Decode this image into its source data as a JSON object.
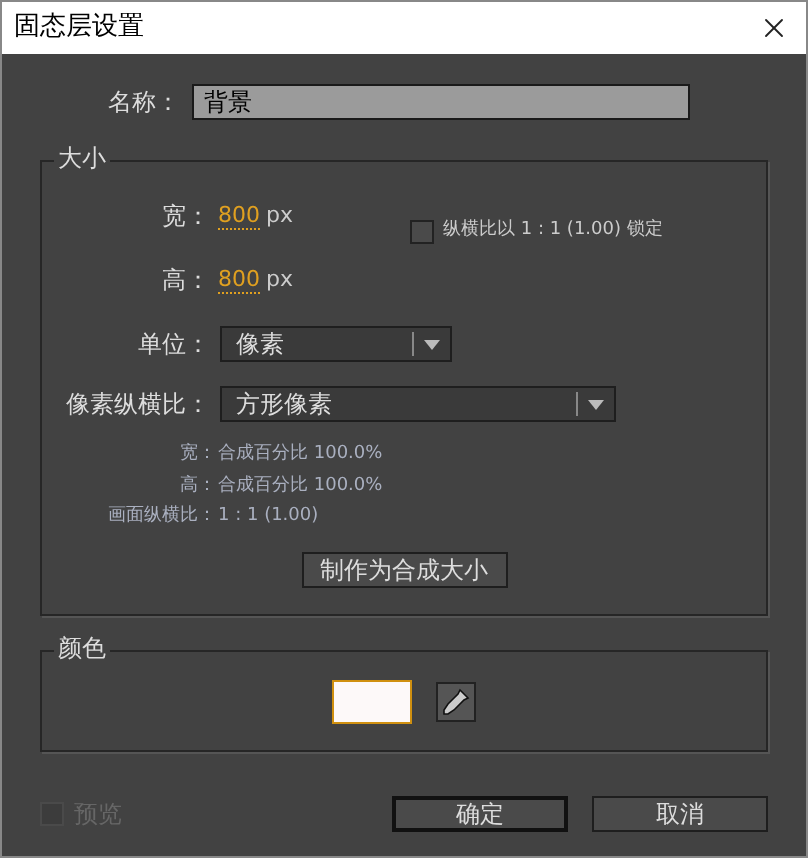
{
  "window": {
    "title": "固态层设置"
  },
  "name": {
    "label": "名称：",
    "value": "背景"
  },
  "size": {
    "title": "大小",
    "width": {
      "label": "宽：",
      "value": "800",
      "unit": "px"
    },
    "height": {
      "label": "高：",
      "value": "800",
      "unit": "px"
    },
    "lock": {
      "label": "纵横比以 1 : 1 (1.00) 锁定",
      "checked": false
    },
    "unit": {
      "label": "单位：",
      "value": "像素"
    },
    "pixel_aspect": {
      "label": "像素纵横比：",
      "value": "方形像素"
    },
    "info": [
      {
        "label": "宽：",
        "value": "合成百分比 100.0%"
      },
      {
        "label": "高：",
        "value": "合成百分比 100.0%"
      },
      {
        "label": "画面纵横比：",
        "value": "1 : 1 (1.00)"
      }
    ],
    "button": "制作为合成大小"
  },
  "color": {
    "title": "颜色"
  },
  "preview": {
    "label": "预览",
    "checked": false,
    "disabled": true
  },
  "buttons": [
    {
      "label": "确定",
      "default": true
    },
    {
      "label": "取消",
      "default": false
    }
  ]
}
